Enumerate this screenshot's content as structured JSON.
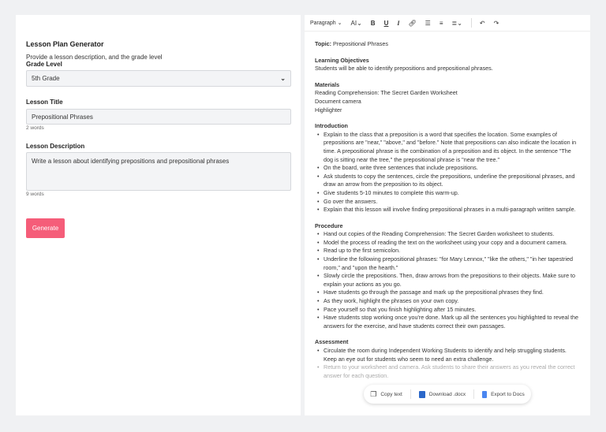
{
  "left": {
    "title": "Lesson Plan Generator",
    "subtitle": "Provide a lesson description, and the grade level",
    "grade_label": "Grade Level",
    "grade_value": "5th Grade",
    "title_label": "Lesson Title",
    "title_value": "Prepositional Phrases",
    "title_count": "2 words",
    "desc_label": "Lesson Description",
    "desc_value": "Write a lesson about identifying prepositions and prepositional phrases",
    "desc_count": "9 words",
    "generate": "Generate",
    "accent": "#f55d79"
  },
  "toolbar": {
    "paragraph": "Paragraph",
    "font_size": "AI",
    "bold": "B",
    "underline": "U",
    "italic": "I",
    "chev": "⌄"
  },
  "doc": {
    "topic_label": "Topic:",
    "topic": "Prepositional Phrases",
    "obj_h": "Learning Objectives",
    "obj": "Students will be able to identify prepositions and prepositional phrases.",
    "mat_h": "Materials",
    "materials": [
      "Reading Comprehension: The Secret Garden Worksheet",
      "Document camera",
      "Highlighter"
    ],
    "intro_h": "Introduction",
    "intro": [
      "Explain to the class that a preposition is a word that specifies the location. Some examples of prepositions are \"near,\" \"above,\" and \"before.\" Note that prepositions can also indicate the location in time. A prepositional phrase is the combination of a preposition and its object. In the sentence \"The dog is sitting near the tree,\" the prepositional phrase is \"near the tree.\"",
      "On the board, write three sentences that include prepositions.",
      "Ask students to copy the sentences, circle the prepositions, underline the prepositional phrases, and draw an arrow from the preposition to its object.",
      "Give students 5-10 minutes to complete this warm-up.",
      "Go over the answers.",
      "Explain that this lesson will involve finding prepositional phrases in a multi-paragraph written sample."
    ],
    "proc_h": "Procedure",
    "procedure": [
      "Hand out copies of the Reading Comprehension: The Secret Garden worksheet to students.",
      "Model the process of reading the text on the worksheet using your copy and a document camera.",
      "Read up to the first semicolon.",
      "Underline the following prepositional phrases: \"for Mary Lennox,\" \"like the others,\" \"in her tapestried room,\" and \"upon the hearth.\"",
      "Slowly circle the prepositions. Then, draw arrows from the prepositions to their objects. Make sure to explain your actions as you go.",
      "Have students go through the passage and mark up the prepositional phrases they find.",
      "As they work, highlight the phrases on your own copy.",
      "Pace yourself so that you finish highlighting after 15 minutes.",
      "Have students stop working once you're done. Mark up all the sentences you highlighted to reveal the answers for the exercise, and have students correct their own passages."
    ],
    "assess_h": "Assessment",
    "assessment": [
      "Circulate the room during Independent Working Students to identify and help struggling students. Keep an eye out for students who seem to need an extra challenge.",
      "Return to your worksheet and camera. Ask students to share their answers as you reveal the correct answer for each question."
    ]
  },
  "actions": {
    "copy": "Copy text",
    "download": "Download .docx",
    "export": "Export to Docs"
  }
}
